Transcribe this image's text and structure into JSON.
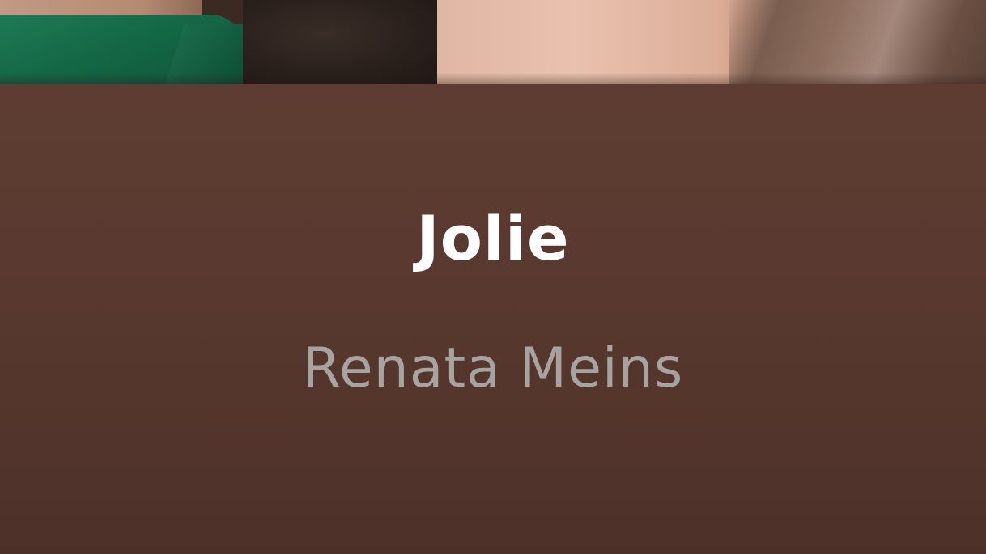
{
  "cover_art": {
    "icon": "album-cover-image"
  },
  "now_playing": {
    "title": "Jolie",
    "artist": "Renata Meins"
  },
  "colors": {
    "panel_background": "#5a3a30",
    "title_color": "#ffffff",
    "artist_color": "#a7a3a0"
  }
}
